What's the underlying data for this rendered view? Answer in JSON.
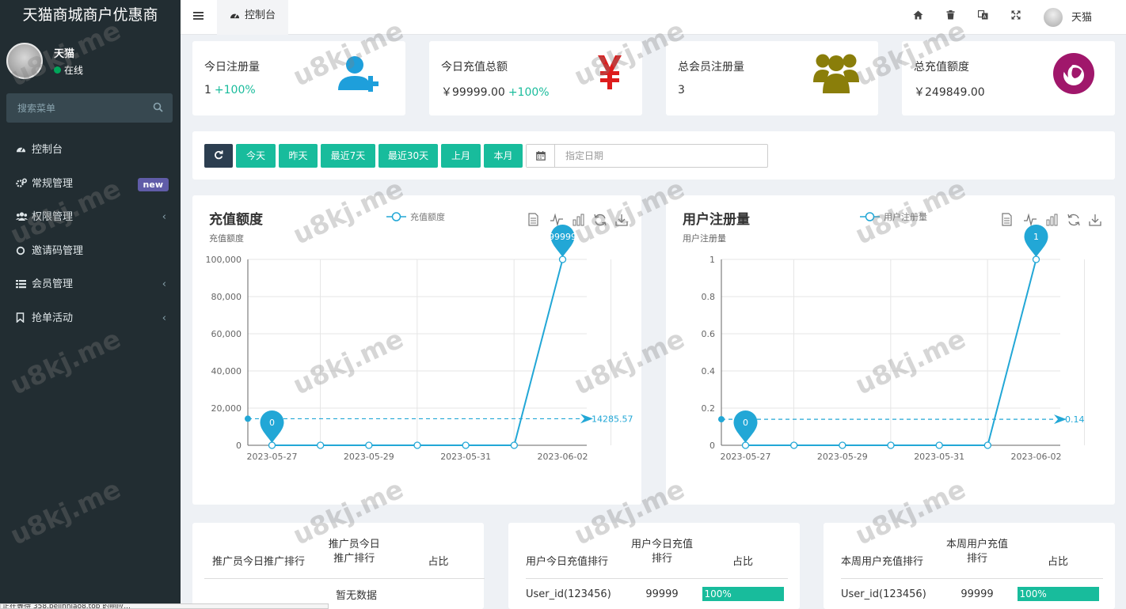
{
  "app": {
    "title": "天猫商城商户优惠商"
  },
  "user": {
    "name": "天猫",
    "status": "在线"
  },
  "search": {
    "placeholder": "搜索菜单"
  },
  "menu": [
    {
      "label": "控制台",
      "icon": "dashboard-icon"
    },
    {
      "label": "常规管理",
      "icon": "cogs-icon",
      "badge": "new"
    },
    {
      "label": "权限管理",
      "icon": "group-icon",
      "chevron": "‹"
    },
    {
      "label": "邀请码管理",
      "icon": "circle-icon"
    },
    {
      "label": "会员管理",
      "icon": "list-icon",
      "chevron": "‹"
    },
    {
      "label": "抢单活动",
      "icon": "bookmark-icon",
      "chevron": "‹"
    }
  ],
  "topbar": {
    "tab_label": "控制台",
    "icons": [
      "home-icon",
      "trash-icon",
      "translate-icon",
      "fullscreen-icon"
    ],
    "user_name": "天猫"
  },
  "stats": [
    {
      "label": "今日注册量",
      "value": "1",
      "pct": "+100%",
      "icon": "user-plus-icon",
      "color": "#1e9fdb"
    },
    {
      "label": "今日充值总额",
      "value": "￥99999.00",
      "pct": "+100%",
      "icon": "yen-icon",
      "color": "#dd1c1c"
    },
    {
      "label": "总会员注册量",
      "value": "3",
      "pct": "",
      "icon": "users-icon",
      "color": "#8a7e0a"
    },
    {
      "label": "总充值额度",
      "value": "￥249849.00",
      "pct": "",
      "icon": "firefox-icon",
      "color": "#a0176b"
    }
  ],
  "filters": {
    "buttons": [
      "今天",
      "昨天",
      "最近7天",
      "最近30天",
      "上月",
      "本月"
    ],
    "date_placeholder": "指定日期"
  },
  "charts_text": [
    {
      "title": "充值额度",
      "subtitle": "充值额度"
    },
    {
      "title": "用户注册量",
      "subtitle": "用户注册量"
    }
  ],
  "chart_data": [
    {
      "type": "line",
      "title": "充值额度",
      "subtitle": "充值额度",
      "legend": [
        "充值额度"
      ],
      "legend_position": "top-center",
      "x": [
        "2023-05-27",
        "2023-05-28",
        "2023-05-29",
        "2023-05-30",
        "2023-05-31",
        "2023-06-01",
        "2023-06-02"
      ],
      "x_tick_labels": [
        "2023-05-27",
        "2023-05-29",
        "2023-05-31",
        "2023-06-02"
      ],
      "series": [
        {
          "name": "充值额度",
          "values": [
            0,
            0,
            0,
            0,
            0,
            0,
            99999
          ]
        }
      ],
      "y_ticks": [
        0,
        20000,
        40000,
        60000,
        80000,
        100000
      ],
      "y_tick_labels": [
        "0",
        "20,000",
        "40,000",
        "60,000",
        "80,000",
        "100,000"
      ],
      "ylim": [
        0,
        100000
      ],
      "mark_points": [
        {
          "label": "0",
          "value": 0,
          "x": "2023-05-27"
        },
        {
          "label": "99999",
          "value": 99999,
          "x": "2023-06-02"
        }
      ],
      "mark_line": {
        "type": "average",
        "value": 14285.57,
        "label": "14285.57"
      },
      "grid": true,
      "color": "#22a7d6",
      "toolbox": [
        "data-view-icon",
        "line-chart-icon",
        "bar-chart-icon",
        "restore-icon",
        "download-icon"
      ]
    },
    {
      "type": "line",
      "title": "用户注册量",
      "subtitle": "用户注册量",
      "legend": [
        "用户注册量"
      ],
      "legend_position": "top-center",
      "x": [
        "2023-05-27",
        "2023-05-28",
        "2023-05-29",
        "2023-05-30",
        "2023-05-31",
        "2023-06-01",
        "2023-06-02"
      ],
      "x_tick_labels": [
        "2023-05-27",
        "2023-05-29",
        "2023-05-31",
        "2023-06-02"
      ],
      "series": [
        {
          "name": "用户注册量",
          "values": [
            0,
            0,
            0,
            0,
            0,
            0,
            1
          ]
        }
      ],
      "y_ticks": [
        0,
        0.2,
        0.4,
        0.6,
        0.8,
        1
      ],
      "y_tick_labels": [
        "0",
        "0.2",
        "0.4",
        "0.6",
        "0.8",
        "1"
      ],
      "ylim": [
        0,
        1
      ],
      "mark_points": [
        {
          "label": "0",
          "value": 0,
          "x": "2023-05-27"
        },
        {
          "label": "1",
          "value": 1,
          "x": "2023-06-02"
        }
      ],
      "mark_line": {
        "type": "average",
        "value": 0.14,
        "label": "0.14"
      },
      "grid": true,
      "color": "#22a7d6",
      "toolbox": [
        "data-view-icon",
        "line-chart-icon",
        "bar-chart-icon",
        "restore-icon",
        "download-icon"
      ]
    }
  ],
  "tables": [
    {
      "headers": [
        "推广员今日推广排行",
        "推广员今日推广排行",
        "占比"
      ],
      "empty": "暂无数据",
      "rows": []
    },
    {
      "headers": [
        "用户今日充值排行",
        "用户今日充值排行",
        "占比"
      ],
      "rows": [
        {
          "user": "User_id(123456)",
          "amount": "99999",
          "pct": "100%"
        }
      ]
    },
    {
      "headers": [
        "本周用户充值排行",
        "本周用户充值排行",
        "占比"
      ],
      "rows": [
        {
          "user": "User_id(123456)",
          "amount": "99999",
          "pct": "100%"
        }
      ]
    }
  ],
  "status_text": "正在等待 358.bejinniao8.top 的响应...",
  "watermark": "u8kj.me"
}
